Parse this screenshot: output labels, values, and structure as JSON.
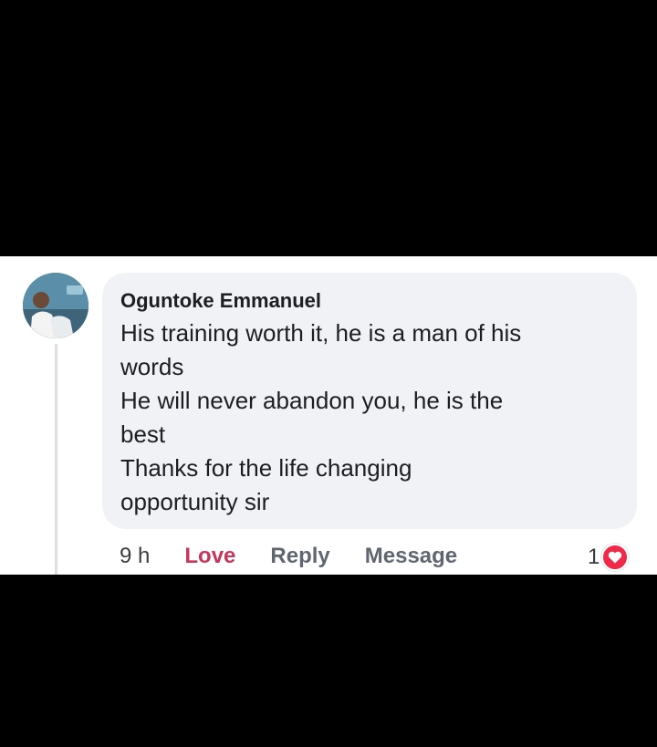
{
  "comment": {
    "author": "Oguntoke Emmanuel",
    "lines": [
      "His training worth it, he is a man of his",
      "words",
      "He will never abandon you, he is the",
      "best",
      "Thanks for the life changing",
      "opportunity sir"
    ]
  },
  "actions": {
    "time": "9 h",
    "love": "Love",
    "reply": "Reply",
    "message": "Message"
  },
  "reactions": {
    "count": "1",
    "icon": "heart-icon"
  },
  "colors": {
    "background": "#000000",
    "panel": "#ffffff",
    "bubble": "#f0f2f5",
    "love_accent": "#c8365a",
    "reaction_heart": "#f02849"
  }
}
